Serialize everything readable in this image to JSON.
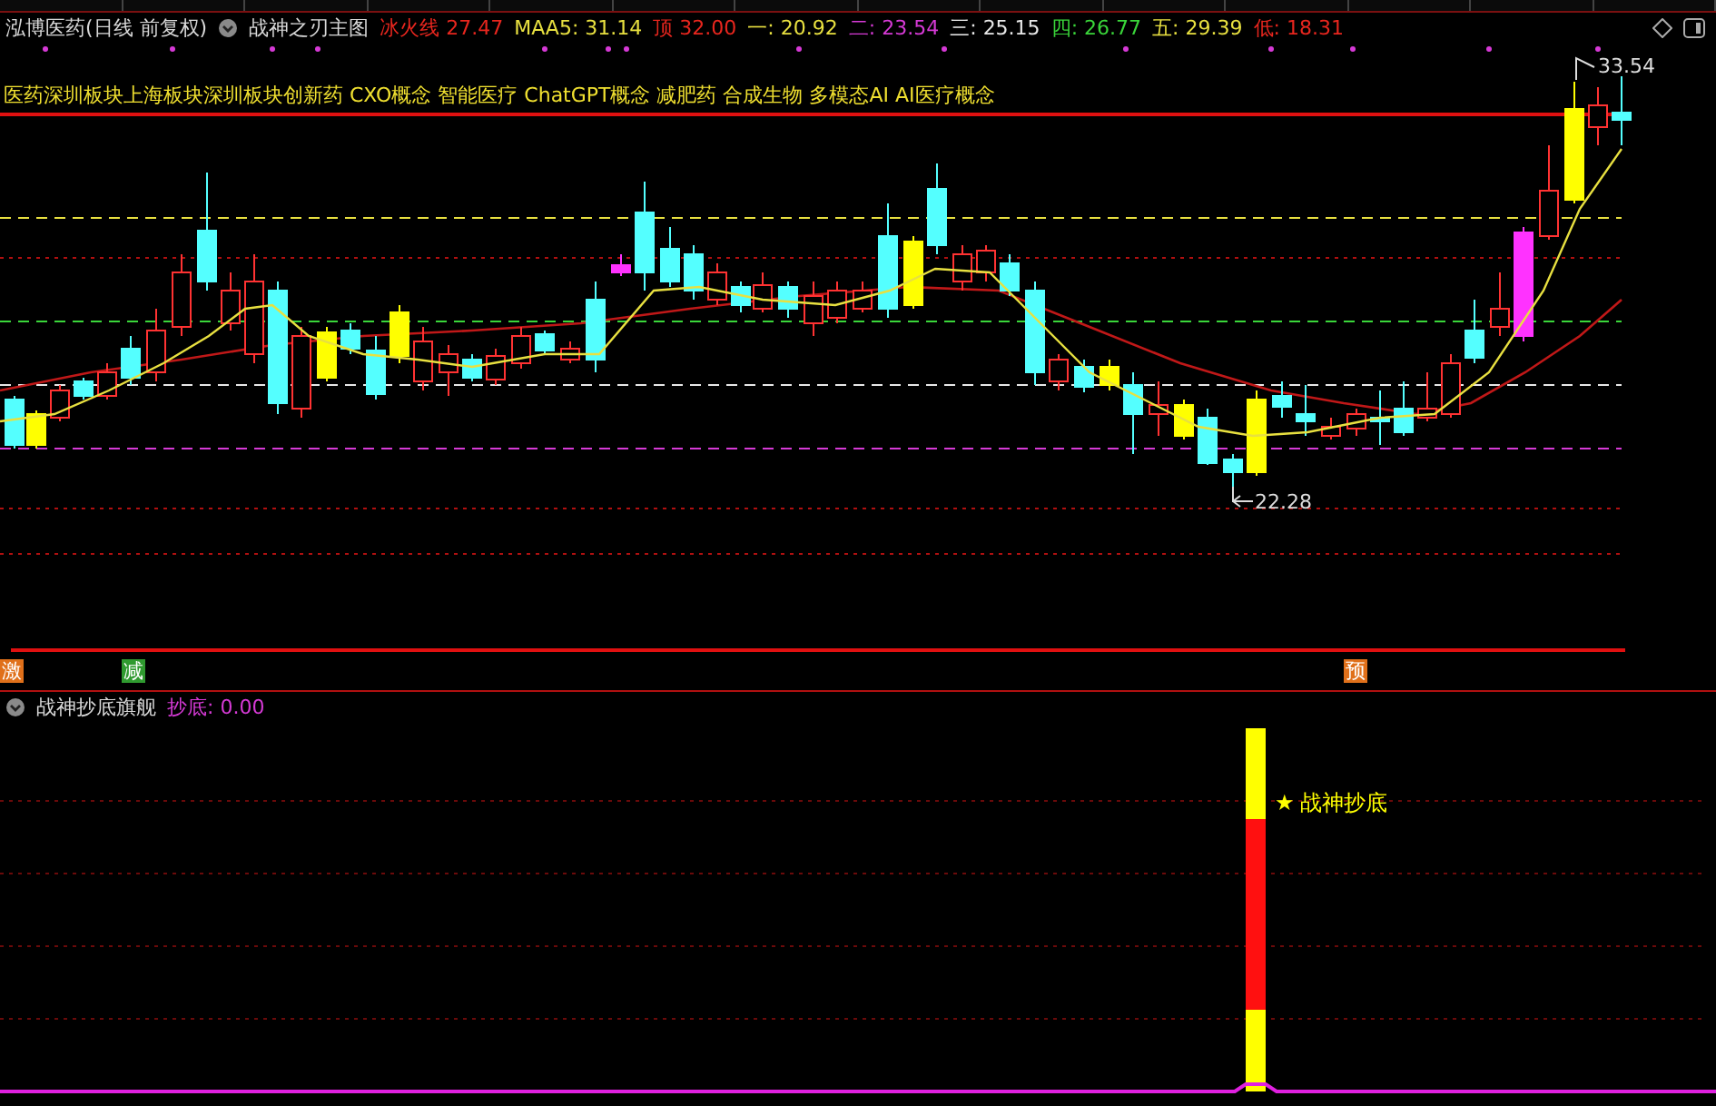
{
  "stock": {
    "title": "泓博医药(日线 前复权)",
    "indicator": "战神之刃主图"
  },
  "readings": [
    {
      "label": "冰火线",
      "value": "27.47",
      "color": "#e8261e"
    },
    {
      "label": "MAA5:",
      "value": "31.14",
      "color": "#e8e040"
    },
    {
      "label": "顶",
      "value": "32.00",
      "color": "#e8261e"
    },
    {
      "label": "一:",
      "value": "20.92",
      "color": "#e8e040"
    },
    {
      "label": "二:",
      "value": "23.54",
      "color": "#d63ad6"
    },
    {
      "label": "三:",
      "value": "25.15",
      "color": "#e8e8e8"
    },
    {
      "label": "四:",
      "value": "26.77",
      "color": "#3ad63a"
    },
    {
      "label": "五:",
      "value": "29.39",
      "color": "#e8e040"
    },
    {
      "label": "低:",
      "value": "18.31",
      "color": "#e8261e"
    }
  ],
  "concepts": "医药深圳板块上海板块深圳板块创新药 CXO概念 智能医疗 ChatGPT概念 减肥药 合成生物 多模态AI AI医疗概念",
  "price_marks": [
    {
      "kind": "high",
      "text": "33.54"
    },
    {
      "kind": "low",
      "text": "22.28"
    }
  ],
  "signals": [
    {
      "text": "激",
      "color": "#e0701a"
    },
    {
      "text": "减",
      "color": "#2f9a2f"
    },
    {
      "text": "预",
      "color": "#e0701a"
    }
  ],
  "sub_panel": {
    "title": "战神抄底旗舰",
    "reading": {
      "label": "抄底:",
      "value": "0.00"
    },
    "signal": {
      "mark": "★",
      "text": "战神抄底"
    }
  }
}
